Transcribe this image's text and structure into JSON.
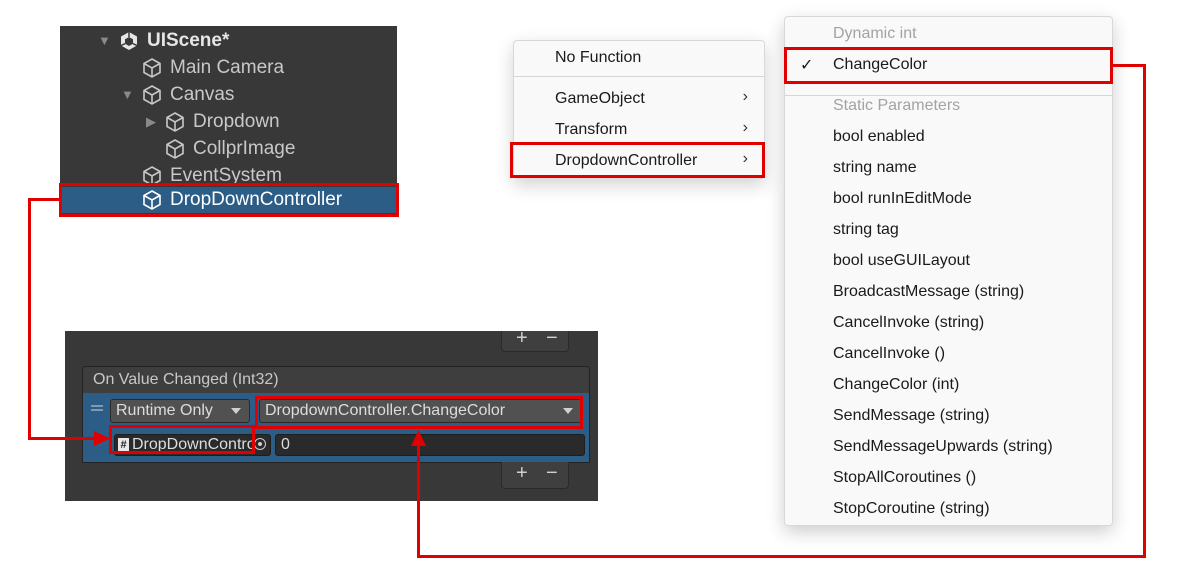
{
  "hierarchy": {
    "scene": "UIScene*",
    "items": [
      {
        "label": "Main Camera"
      },
      {
        "label": "Canvas"
      },
      {
        "label": "Dropdown"
      },
      {
        "label": "CollprImage"
      },
      {
        "label": "EventSystem"
      },
      {
        "label": "DropDownController",
        "selected": true
      }
    ]
  },
  "inspector": {
    "plus_label": "+",
    "minus_label": "−",
    "event_header": "On Value Changed (Int32)",
    "runtime_dropdown": "Runtime Only",
    "function_dropdown": "DropdownController.ChangeColor",
    "object_field": "DropDownController",
    "value_field": "0"
  },
  "context_menu": {
    "items": [
      {
        "label": "No Function"
      },
      {
        "label": "GameObject",
        "has_submenu": true
      },
      {
        "label": "Transform",
        "has_submenu": true
      },
      {
        "label": "DropdownController",
        "has_submenu": true
      }
    ]
  },
  "submenu": {
    "dynamic_header": "Dynamic int",
    "selected_item": "ChangeColor",
    "static_header": "Static Parameters",
    "items": [
      "bool enabled",
      "string name",
      "bool runInEditMode",
      "string tag",
      "bool useGUILayout",
      "BroadcastMessage (string)",
      "CancelInvoke (string)",
      "CancelInvoke ()",
      "ChangeColor (int)",
      "SendMessage (string)",
      "SendMessageUpwards (string)",
      "StopAllCoroutines ()",
      "StopCoroutine (string)"
    ]
  },
  "icons": {
    "unity": "unity-logo-icon",
    "gameobject": "cube-icon",
    "check": "checkmark-icon",
    "chevron": "chevron-right-icon"
  },
  "colors": {
    "highlight": "#e00000",
    "selection_blue": "#2c5d87",
    "panel_dark": "#383838"
  }
}
